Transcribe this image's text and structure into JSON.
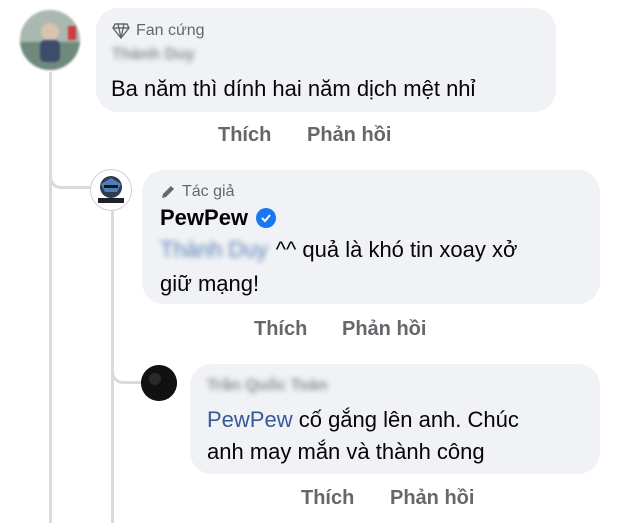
{
  "comment1": {
    "badge": "Fan cứng",
    "author_blurred": "Thành Duy",
    "text": "Ba năm thì dính hai năm dịch mệt nhỉ",
    "like_label": "Thích",
    "reply_label": "Phản hồi"
  },
  "reply1": {
    "badge": "Tác giả",
    "author": "PewPew",
    "mention_blurred": "Thành Duy",
    "text_line1": "^^ quả là khó tin xoay xở",
    "text_line2": "giữ mạng!",
    "like_label": "Thích",
    "reply_label": "Phản hồi"
  },
  "reply2": {
    "author_blurred": "Trần Quốc Toàn",
    "mention": "PewPew",
    "text_line1": "cố gắng lên anh. Chúc",
    "text_line2": "anh may mắn và thành công",
    "like_label": "Thích",
    "reply_label": "Phản hồi"
  },
  "colors": {
    "bubble": "#f0f2f5",
    "mention": "#385898",
    "verified": "#1877f2",
    "action": "#65676b"
  }
}
